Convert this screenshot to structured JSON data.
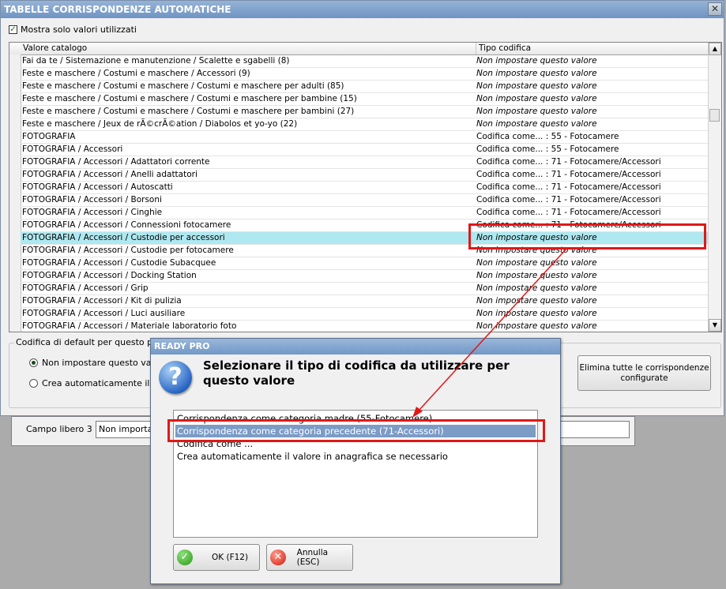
{
  "window": {
    "title": "TABELLE CORRISPONDENZE AUTOMATICHE",
    "close_label": "✕",
    "checkbox_label": "Mostra solo valori utilizzati"
  },
  "grid": {
    "headers": [
      "Valore catalogo",
      "Tipo codifica"
    ],
    "rows": [
      [
        "Fai da te / Sistemazione e manutenzione / Scalette e sgabelli (8)",
        "Non impostare questo valore"
      ],
      [
        "Feste e maschere / Costumi e maschere / Accessori (9)",
        "Non impostare questo valore"
      ],
      [
        "Feste e maschere / Costumi e maschere / Costumi e maschere per adulti (85)",
        "Non impostare questo valore"
      ],
      [
        "Feste e maschere / Costumi e maschere / Costumi e maschere per bambine (15)",
        "Non impostare questo valore"
      ],
      [
        "Feste e maschere / Costumi e maschere / Costumi e maschere per bambini (27)",
        "Non impostare questo valore"
      ],
      [
        "Feste e maschere / Jeux de rÃ©crÃ©ation / Diabolos et yo-yo (22)",
        "Non impostare questo valore"
      ],
      [
        "FOTOGRAFIA",
        "Codifica come... : 55 - Fotocamere"
      ],
      [
        "FOTOGRAFIA / Accessori",
        "Codifica come... : 55 - Fotocamere"
      ],
      [
        "FOTOGRAFIA / Accessori / Adattatori corrente",
        "Codifica come... : 71 - Fotocamere/Accessori"
      ],
      [
        "FOTOGRAFIA / Accessori / Anelli adattatori",
        "Codifica come... : 71 - Fotocamere/Accessori"
      ],
      [
        "FOTOGRAFIA / Accessori / Autoscatti",
        "Codifica come... : 71 - Fotocamere/Accessori"
      ],
      [
        "FOTOGRAFIA / Accessori / Borsoni",
        "Codifica come... : 71 - Fotocamere/Accessori"
      ],
      [
        "FOTOGRAFIA / Accessori / Cinghie",
        "Codifica come... : 71 - Fotocamere/Accessori"
      ],
      [
        "FOTOGRAFIA / Accessori / Connessioni fotocamere",
        "Codifica come... : 71 - Fotocamere/Accessori"
      ],
      [
        "FOTOGRAFIA / Accessori / Custodie per accessori",
        "Non impostare questo valore"
      ],
      [
        "FOTOGRAFIA / Accessori / Custodie per fotocamere",
        "Non impostare questo valore"
      ],
      [
        "FOTOGRAFIA / Accessori / Custodie Subacquee",
        "Non impostare questo valore"
      ],
      [
        "FOTOGRAFIA / Accessori / Docking Station",
        "Non impostare questo valore"
      ],
      [
        "FOTOGRAFIA / Accessori / Grip",
        "Non impostare questo valore"
      ],
      [
        "FOTOGRAFIA / Accessori / Kit di pulizia",
        "Non impostare questo valore"
      ],
      [
        "FOTOGRAFIA / Accessori / Luci ausiliare",
        "Non impostare questo valore"
      ],
      [
        "FOTOGRAFIA / Accessori / Materiale laboratorio foto",
        "Non impostare questo valore"
      ]
    ],
    "selected_row": 14
  },
  "default_group": {
    "title": "Codifica di default per questo param",
    "radio1": "Non impostare questo valore",
    "radio2": "Crea automaticamente il valor"
  },
  "elimina_button": "Elimina tutte le corrispondenze configurate",
  "campo": {
    "label": "Campo libero 3 :",
    "value": "Non importare"
  },
  "dialog": {
    "title": "READY PRO",
    "message": "Selezionare il tipo di codifica da utilizzare per questo valore",
    "options": [
      "Corrispondenza come categoria madre (55-Fotocamere)",
      "Corrispondenza come categoria precedente (71-Accessori)",
      "Codifica come ...",
      "Crea automaticamente il valore in anagrafica se necessario"
    ],
    "selected_option": 1,
    "ok_label": "OK (F12)",
    "cancel_label": "Annulla (ESC)"
  },
  "colors": {
    "highlight": "#e01818",
    "row_selected": "#aee8f0",
    "list_selected": "#7c9cc6"
  }
}
